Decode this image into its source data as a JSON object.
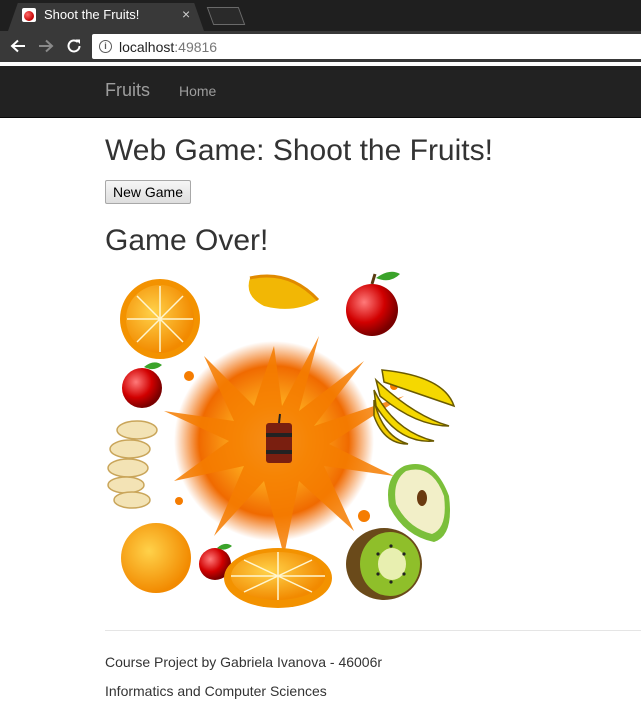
{
  "browser": {
    "tab_title": "Shoot the Fruits!",
    "tab_close": "×",
    "url_host": "localhost",
    "url_port": ":49816"
  },
  "navbar": {
    "brand": "Fruits",
    "links": [
      "Home"
    ]
  },
  "main": {
    "title": "Web Game: Shoot the Fruits!",
    "new_game_label": "New Game",
    "status": "Game Over!"
  },
  "footer": {
    "line1": "Course Project by Gabriela Ivanova - 46006r",
    "line2": "Informatics and Computer Sciences"
  },
  "colors": {
    "navbar_bg": "#222222",
    "nav_text": "#9d9d9d",
    "chrome_bg": "#393939"
  }
}
